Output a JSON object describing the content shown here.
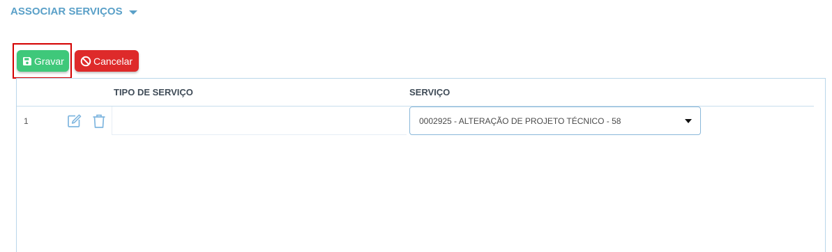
{
  "section": {
    "title": "ASSOCIAR SERVIÇOS"
  },
  "toolbar": {
    "save_label": "Gravar",
    "cancel_label": "Cancelar"
  },
  "table": {
    "columns": [
      "TIPO DE SERVIÇO",
      "SERVIÇO"
    ],
    "rows": [
      {
        "index": "1",
        "tipo_servico": "",
        "servico": "0002925 - ALTERAÇÃO DE PROJETO TÉCNICO - 58"
      }
    ]
  },
  "colors": {
    "section_title": "#5aa0c8",
    "save_button": "#3fc87a",
    "cancel_button": "#de2a2a",
    "highlight": "#d40000",
    "icon_blue": "#7fb6df"
  },
  "icons": {
    "section_toggle": "chevron-down-icon",
    "save": "floppy-disk-icon",
    "cancel": "ban-icon",
    "edit": "edit-icon",
    "delete": "trash-icon",
    "select_arrow": "dropdown-arrow-icon"
  }
}
